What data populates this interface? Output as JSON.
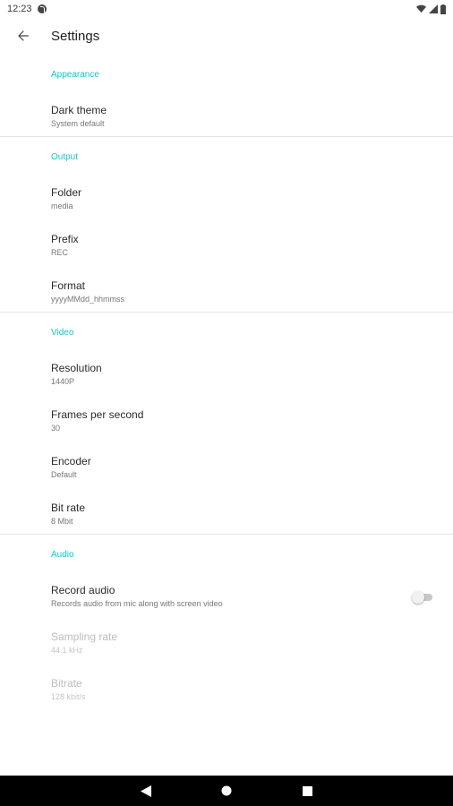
{
  "status_bar": {
    "time": "12:23"
  },
  "app_bar": {
    "title": "Settings"
  },
  "sections": {
    "appearance": {
      "header": "Appearance",
      "dark_theme": {
        "title": "Dark theme",
        "summary": "System default"
      }
    },
    "output": {
      "header": "Output",
      "folder": {
        "title": "Folder",
        "summary": "media"
      },
      "prefix": {
        "title": "Prefix",
        "summary": "REC"
      },
      "format": {
        "title": "Format",
        "summary": "yyyyMMdd_hhmmss"
      }
    },
    "video": {
      "header": "Video",
      "resolution": {
        "title": "Resolution",
        "summary": "1440P"
      },
      "fps": {
        "title": "Frames per second",
        "summary": "30"
      },
      "encoder": {
        "title": "Encoder",
        "summary": "Default"
      },
      "bit_rate": {
        "title": "Bit rate",
        "summary": "8 Mbit"
      }
    },
    "audio": {
      "header": "Audio",
      "record_audio": {
        "title": "Record audio",
        "summary": "Records audio from mic along with screen video",
        "enabled": false
      },
      "sampling_rate": {
        "title": "Sampling rate",
        "summary": "44.1 kHz"
      },
      "bitrate": {
        "title": "Bitrate",
        "summary": "128 kbit/s"
      }
    }
  },
  "colors": {
    "accent": "#1ec1c1",
    "nav_bar": "#000000",
    "background": "#ffffff"
  },
  "icons": {
    "back": "arrow-left-icon",
    "nav_back": "triangle-back-icon",
    "nav_home": "circle-home-icon",
    "nav_recents": "square-recents-icon"
  }
}
